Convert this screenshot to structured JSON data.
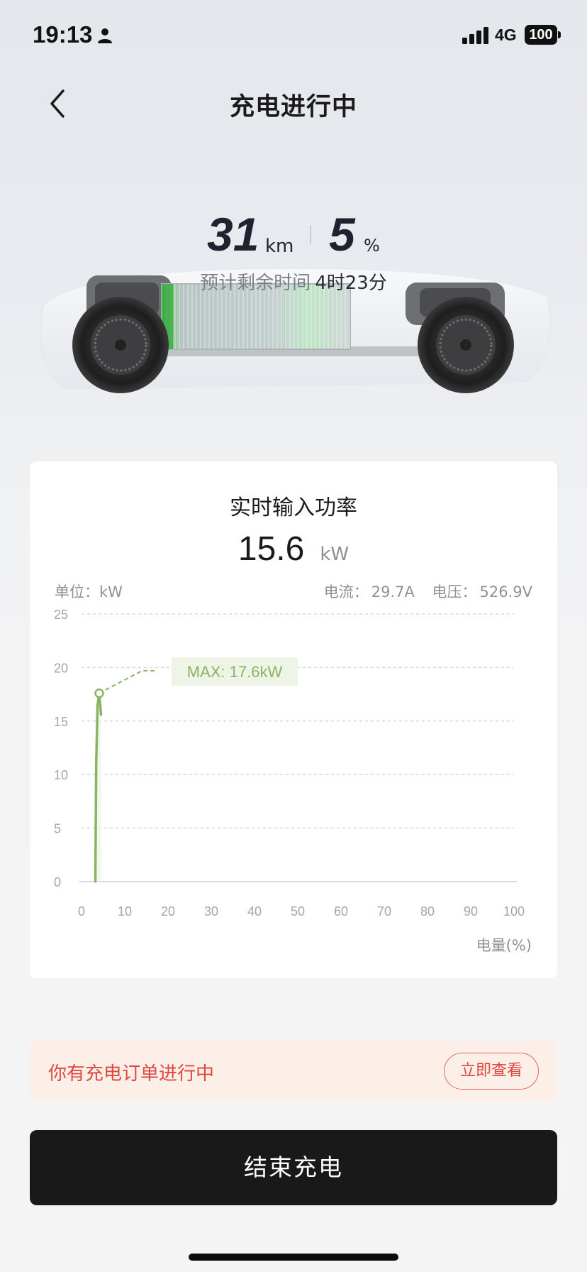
{
  "status_bar": {
    "time": "19:13",
    "network": "4G",
    "battery": "100",
    "icons": [
      "person-icon",
      "signal-icon",
      "battery-icon"
    ]
  },
  "header": {
    "title": "充电进行中",
    "back_icon": "chevron-left-icon"
  },
  "vehicle": {
    "range_value": "31",
    "range_unit": "km",
    "soc_value": "5",
    "soc_unit": "%",
    "eta_label": "预计剩余时间",
    "eta_value": "4时23分"
  },
  "power_card": {
    "title": "实时输入功率",
    "power_value": "15.6",
    "power_unit": "kW",
    "unit_label": "单位：kW",
    "current_label": "电流：",
    "current_value": "29.7A",
    "voltage_label": "电压：",
    "voltage_value": "526.9V",
    "max_label": "MAX: 17.6kW"
  },
  "chart_data": {
    "type": "line",
    "title": "实时输入功率",
    "xlabel": "电量(%)",
    "ylabel": "单位：kW",
    "xlim": [
      0,
      100
    ],
    "ylim": [
      0,
      25
    ],
    "x_ticks": [
      0,
      10,
      20,
      30,
      40,
      50,
      60,
      70,
      80,
      90,
      100
    ],
    "y_ticks": [
      0,
      5,
      10,
      15,
      20,
      25
    ],
    "grid": true,
    "series": [
      {
        "x": [
          3.2,
          3.4,
          3.7,
          4.1,
          4.5
        ],
        "y": [
          0,
          11,
          16.5,
          17.6,
          15.6
        ],
        "color": "#8ab465"
      }
    ],
    "max_marker": {
      "x": 4.1,
      "y": 17.6,
      "label": "MAX: 17.6kW"
    },
    "colors": {
      "line": "#8ab465",
      "grid": "#d9d9d9",
      "axis": "#dcdcdc",
      "tick": "#a2a5aa",
      "max_bg": "#eef5e6"
    }
  },
  "order_banner": {
    "text": "你有充电订单进行中",
    "button_label": "立即查看"
  },
  "footer": {
    "stop_label": "结束充电"
  }
}
